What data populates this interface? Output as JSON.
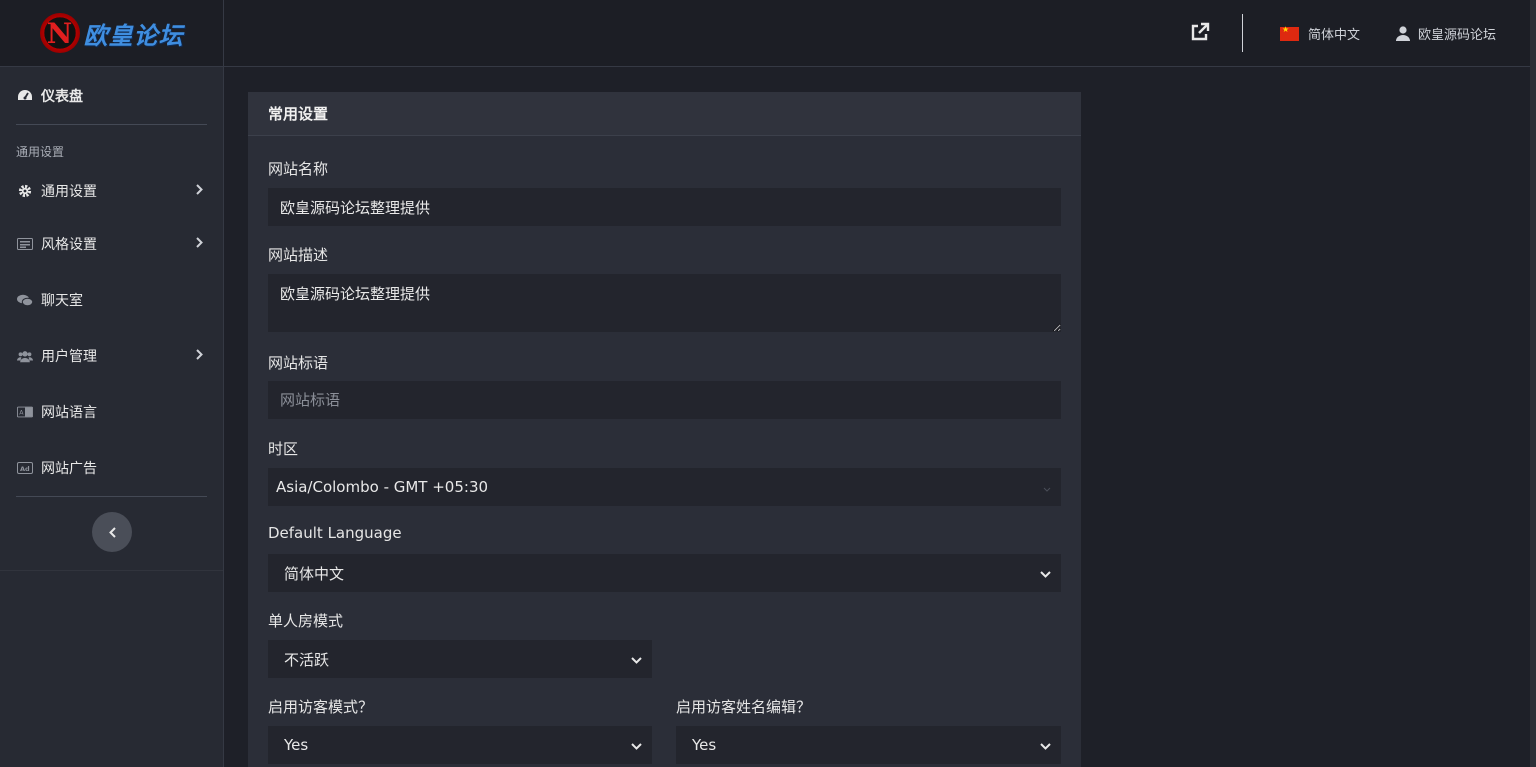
{
  "brand": {
    "mark": "N",
    "name": "欧皇论坛"
  },
  "sidebar": {
    "dashboard": "仪表盘",
    "section_title": "通用设置",
    "items": [
      {
        "label": "通用设置",
        "icon": "gear-icon",
        "has_children": true
      },
      {
        "label": "风格设置",
        "icon": "palette-icon",
        "has_children": true
      },
      {
        "label": "聊天室",
        "icon": "chat-icon",
        "has_children": false
      },
      {
        "label": "用户管理",
        "icon": "users-icon",
        "has_children": true
      },
      {
        "label": "网站语言",
        "icon": "language-icon",
        "has_children": false
      },
      {
        "label": "网站广告",
        "icon": "ad-icon",
        "has_children": false
      }
    ]
  },
  "topbar": {
    "language": "简体中文",
    "user": "欧皇源码论坛"
  },
  "form": {
    "card_title": "常用设置",
    "site_name": {
      "label": "网站名称",
      "value": "欧皇源码论坛整理提供"
    },
    "site_description": {
      "label": "网站描述",
      "value": "欧皇源码论坛整理提供"
    },
    "site_slogan": {
      "label": "网站标语",
      "placeholder": "网站标语"
    },
    "timezone": {
      "label": "时区",
      "value": "Asia/Colombo - GMT +05:30"
    },
    "default_language": {
      "label": "Default Language",
      "value": "简体中文"
    },
    "single_room_mode": {
      "label": "单人房模式",
      "value": "不活跃"
    },
    "guest_mode": {
      "label": "启用访客模式？",
      "value": "Yes"
    },
    "guest_name_edit": {
      "label": "启用访客姓名编辑？",
      "value": "Yes"
    }
  },
  "colors": {
    "background": "#1e2028",
    "sidebar": "#272a33",
    "card": "#2b2e38",
    "input": "#23252d",
    "brand_blue": "#3f8ee0",
    "brand_red": "#e01f1f"
  }
}
